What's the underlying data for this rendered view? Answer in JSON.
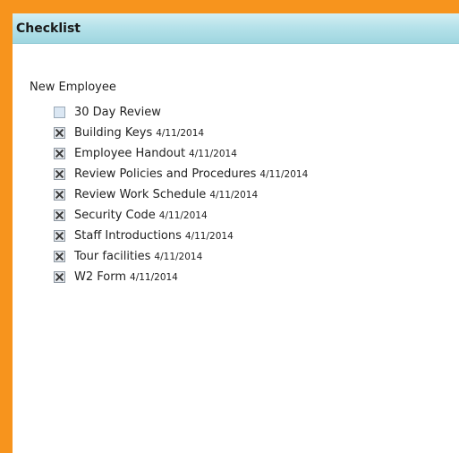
{
  "panel": {
    "title": "Checklist"
  },
  "checklist": {
    "group_label": "New Employee",
    "items": [
      {
        "label": "30 Day Review",
        "date": "",
        "checked": false
      },
      {
        "label": "Building Keys",
        "date": "4/11/2014",
        "checked": true
      },
      {
        "label": "Employee Handout",
        "date": "4/11/2014",
        "checked": true
      },
      {
        "label": "Review Policies and Procedures",
        "date": "4/11/2014",
        "checked": true
      },
      {
        "label": "Review Work Schedule",
        "date": "4/11/2014",
        "checked": true
      },
      {
        "label": "Security Code",
        "date": "4/11/2014",
        "checked": true
      },
      {
        "label": "Staff Introductions",
        "date": "4/11/2014",
        "checked": true
      },
      {
        "label": "Tour facilities",
        "date": "4/11/2014",
        "checked": true
      },
      {
        "label": "W2 Form",
        "date": "4/11/2014",
        "checked": true
      }
    ]
  },
  "colors": {
    "background_frame": "#f7941d",
    "header_accent": "#b6e2ea"
  },
  "icons": {
    "check": "x-mark-icon"
  }
}
